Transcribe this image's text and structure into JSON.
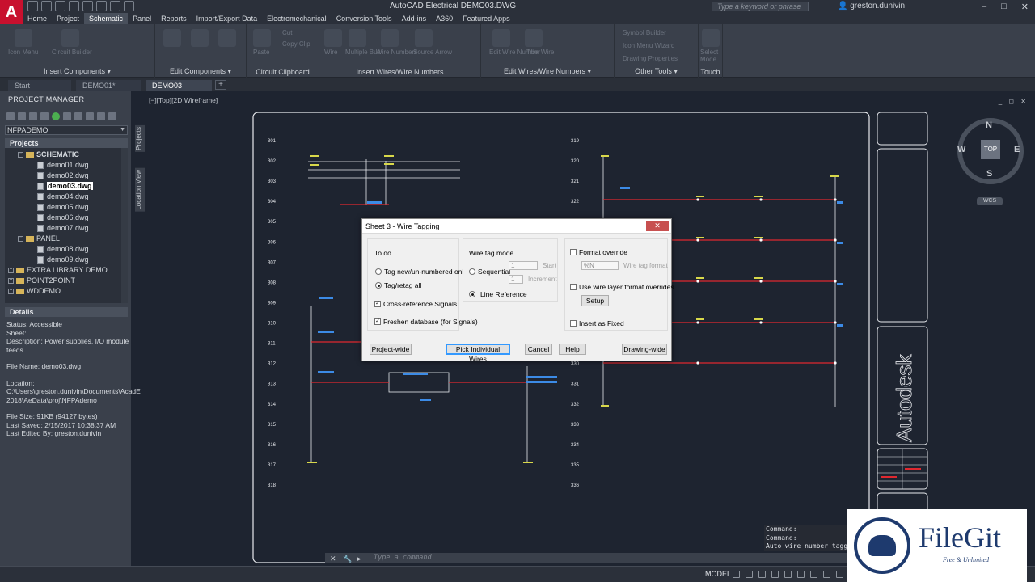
{
  "window": {
    "title": "AutoCAD Electrical   DEMO03.DWG",
    "search_placeholder": "Type a keyword or phrase",
    "user": "greston.dunivin",
    "logo": "A"
  },
  "menu_tabs": [
    "Home",
    "Project",
    "Schematic",
    "Panel",
    "Reports",
    "Import/Export Data",
    "Electromechanical",
    "Conversion Tools",
    "Add-ins",
    "A360",
    "Featured Apps"
  ],
  "menu_active": "Schematic",
  "ribbon_panels": [
    "Insert Components ▾",
    "Edit Components ▾",
    "Circuit Clipboard",
    "Insert Wires/Wire Numbers",
    "Edit Wires/Wire Numbers ▾",
    "Other Tools ▾",
    "Touch"
  ],
  "ribbon_small": {
    "insert": [
      "Icon Menu",
      "Circuit Builder"
    ],
    "clipboard": [
      "Cut",
      "Copy Clip",
      "Paste"
    ],
    "wires": [
      "Wire",
      "Multiple Bus",
      "Wire Numbers",
      "Source Arrow"
    ],
    "editwires": [
      "Edit Wire Number",
      "Trim Wire"
    ],
    "other": [
      "Symbol Builder",
      "Icon Menu Wizard",
      "Drawing Properties"
    ],
    "touch": [
      "Select Mode"
    ]
  },
  "doc_tabs": [
    "Start",
    "DEMO01*",
    "DEMO03"
  ],
  "doc_active": "DEMO03",
  "project_manager": {
    "title": "PROJECT MANAGER",
    "project": "NFPADEMO",
    "projects_header": "Projects",
    "tree": {
      "schematic": "SCHEMATIC",
      "files1": [
        "demo01.dwg",
        "demo02.dwg",
        "demo03.dwg",
        "demo04.dwg",
        "demo05.dwg",
        "demo06.dwg",
        "demo07.dwg"
      ],
      "panel": "PANEL",
      "files2": [
        "demo08.dwg",
        "demo09.dwg"
      ],
      "others": [
        "EXTRA LIBRARY DEMO",
        "POINT2POINT",
        "WDDEMO"
      ]
    },
    "side_tabs": [
      "Projects",
      "Location View"
    ],
    "details_header": "Details",
    "details": [
      "Status: Accessible",
      "Sheet:",
      "Description: Power supplies, I/O module feeds",
      "",
      "File Name: demo03.dwg",
      "",
      "Location: C:\\Users\\greston.dunivin\\Documents\\AcadE 2018\\AeData\\proj\\NFPAdemo",
      "",
      "File Size: 91KB (94127 bytes)",
      "Last Saved: 2/15/2017 10:38:37 AM",
      "Last Edited By: greston.dunivin"
    ]
  },
  "viewport": {
    "label": "[−][Top][2D Wireframe]",
    "controls": "_ ◻ ✕",
    "viewcube": {
      "top": "TOP",
      "n": "N",
      "s": "S",
      "e": "E",
      "w": "W",
      "wcs": "WCS"
    },
    "rungs_left": [
      "301",
      "302",
      "303",
      "304",
      "305",
      "306",
      "307",
      "308",
      "309",
      "310",
      "311",
      "312",
      "313",
      "314",
      "315",
      "316",
      "317",
      "318"
    ],
    "rungs_right": [
      "319",
      "320",
      "321",
      "322",
      "323",
      "324",
      "325",
      "326",
      "327",
      "328",
      "329",
      "330",
      "331",
      "332",
      "333",
      "334",
      "335",
      "336"
    ],
    "title_block_text": "Autodesk"
  },
  "dialog": {
    "title": "Sheet 3 - Wire Tagging",
    "close": "✕",
    "todo": {
      "label": "To do",
      "opt1": "Tag new/un-numbered only",
      "opt2": "Tag/retag all",
      "selected": "opt2"
    },
    "cross_ref": "Cross-reference Signals",
    "freshen": "Freshen database (for Signals)",
    "mode": {
      "label": "Wire tag mode",
      "sequential": "Sequential",
      "start_value": "1",
      "start_label": "Start",
      "increment_value": "1",
      "increment_label": "Increment",
      "line_ref": "Line Reference",
      "selected": "line_ref"
    },
    "format": {
      "override": "Format override",
      "value": "%N",
      "value_label": "Wire tag format",
      "layer": "Use wire layer format overrides",
      "setup": "Setup",
      "fixed": "Insert as Fixed"
    },
    "buttons": {
      "project_wide": "Project-wide",
      "pick": "Pick Individual Wires",
      "cancel": "Cancel",
      "help": "Help",
      "drawing_wide": "Drawing-wide"
    },
    "checks": {
      "cross_ref": true,
      "freshen": true,
      "override": false,
      "layer": false,
      "fixed": false
    }
  },
  "command": {
    "history": [
      "Command:",
      "Command:",
      "Auto wire number taggi"
    ],
    "placeholder": "Type a command"
  },
  "status": {
    "model": "MODEL"
  },
  "watermark": {
    "name": "FileGit",
    "tagline": "Free & Unlimited"
  },
  "colors": {
    "accent": "#c8102e",
    "wire_red": "#e0282f",
    "label_yellow": "#d8d84a",
    "tag_blue": "#3c8be6",
    "bg": "#1e2430"
  }
}
